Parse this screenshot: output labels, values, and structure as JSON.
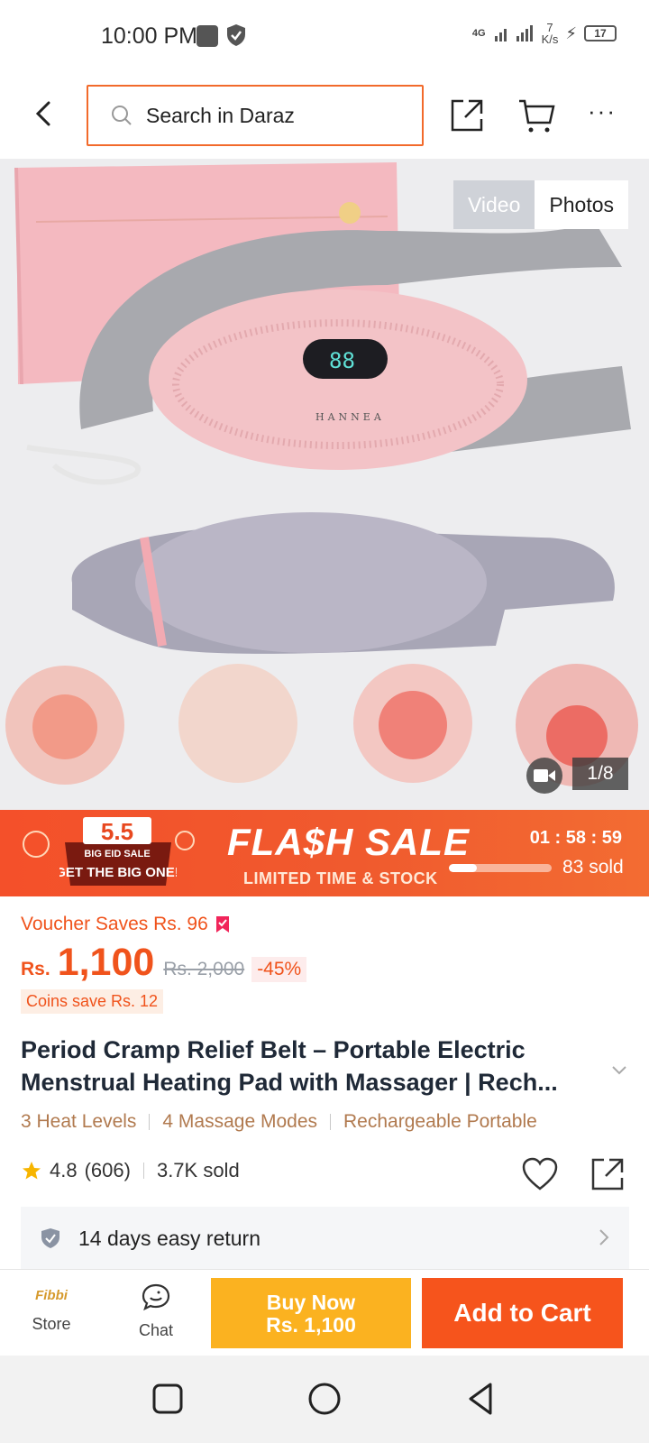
{
  "status_bar": {
    "time": "10:00 PM",
    "net_speed_value": "7",
    "net_speed_unit": "K/s",
    "battery": "17",
    "network_type": "4G"
  },
  "header": {
    "search_placeholder": "Search in Daraz",
    "icons": [
      "back-arrow-icon",
      "search-icon",
      "share-icon",
      "cart-icon",
      "more-icon"
    ]
  },
  "gallery": {
    "tabs": [
      "Video",
      "Photos"
    ],
    "active_tab": "Photos",
    "page_counter": "1/8",
    "product_brand_on_image": "HANNEA",
    "display_on_device": "88"
  },
  "flash_sale": {
    "badge_top": "5.5",
    "badge_line1": "BIG EID SALE",
    "badge_line2": "GET THE BIG ONE!",
    "title": "FLA$H SALE",
    "subtitle": "LIMITED TIME & STOCK",
    "countdown": "01 : 58 : 59",
    "sold_text": "83 sold",
    "sold_progress": 0.27
  },
  "product": {
    "voucher": "Voucher Saves Rs. 96",
    "currency": "Rs.",
    "price": "1,100",
    "original_price": "Rs. 2,000",
    "discount": "-45%",
    "coins": "Coins save Rs. 12",
    "title": "Period Cramp Relief Belt – Portable Electric Menstrual Heating Pad with Massager | Rech...",
    "features": [
      "3 Heat Levels",
      "4 Massage Modes",
      "Rechargeable Portable"
    ],
    "rating": "4.8",
    "reviews": "(606)",
    "sold": "3.7K sold",
    "return_policy": "14 days easy return"
  },
  "action_bar": {
    "store_logo": "Fibbi",
    "store_label": "Store",
    "chat_label": "Chat",
    "buy_now_line1": "Buy Now",
    "buy_now_line2": "Rs. 1,100",
    "add_to_cart": "Add to Cart"
  },
  "colors": {
    "accent": "#f6541c",
    "buy_now": "#fbb220",
    "feature_text": "#b17a4f",
    "flash_bg": "#f4502a"
  }
}
